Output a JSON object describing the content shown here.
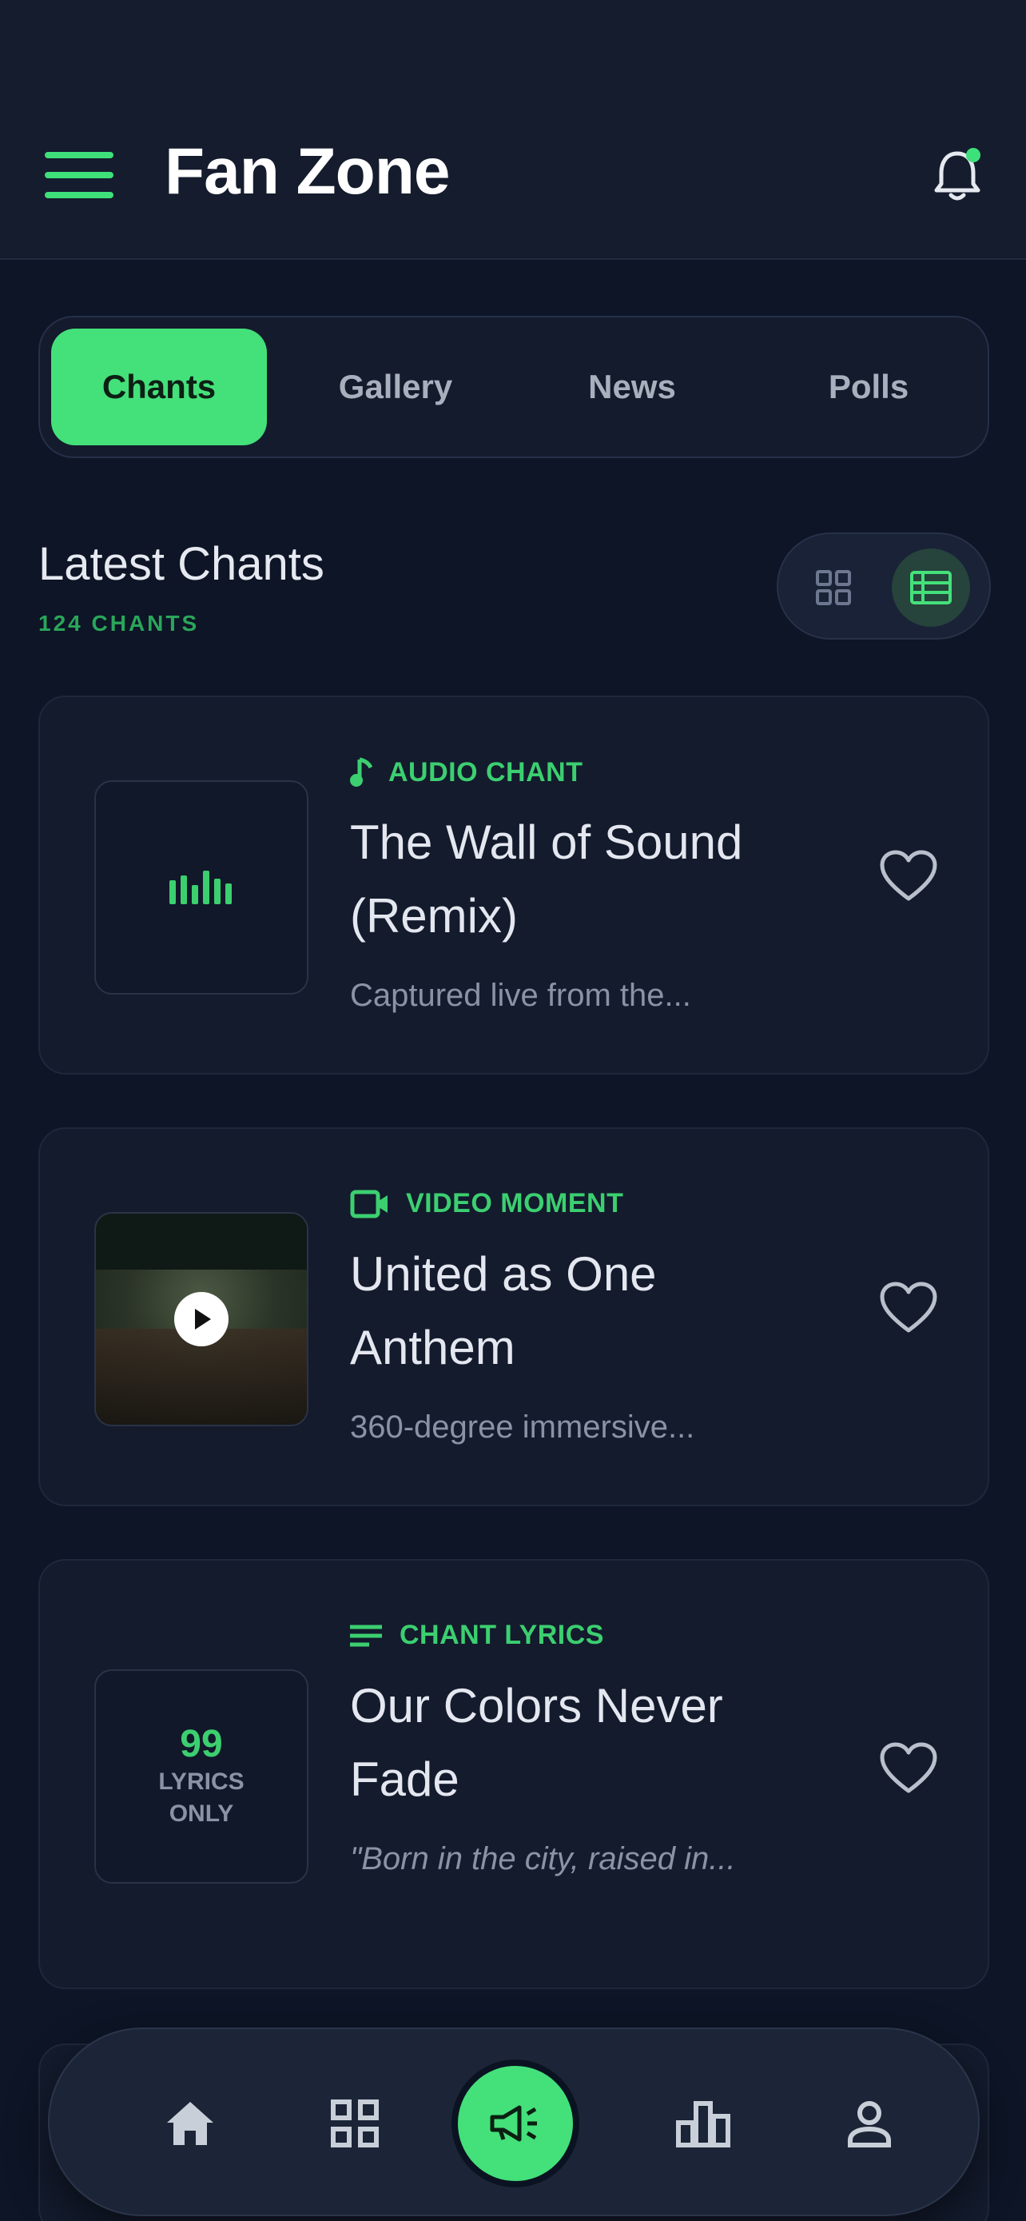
{
  "header": {
    "title": "Fan Zone",
    "menu_icon": "hamburger-menu-icon",
    "notification_icon": "bell-icon",
    "notification_dot_color": "#3ee07a"
  },
  "tabs": [
    {
      "label": "Chants",
      "active": true
    },
    {
      "label": "Gallery",
      "active": false
    },
    {
      "label": "News",
      "active": false
    },
    {
      "label": "Polls",
      "active": false
    }
  ],
  "section": {
    "title": "Latest Chants",
    "count": "124 CHANTS"
  },
  "view_toggle": {
    "options": [
      "grid",
      "list"
    ],
    "selected": "list"
  },
  "cards": [
    {
      "type": "AUDIO CHANT",
      "type_icon": "music-note-icon",
      "title": "The Wall of Sound (Remix)",
      "description": "Captured live from the...",
      "thumb": "audio-waveform-icon",
      "favorite_icon": "heart-icon"
    },
    {
      "type": "VIDEO MOMENT",
      "type_icon": "video-camera-icon",
      "title": "United as One Anthem",
      "description": "360-degree immersive...",
      "thumb": "video-thumbnail",
      "favorite_icon": "heart-icon"
    },
    {
      "type": "CHANT LYRICS",
      "type_icon": "lyrics-lines-icon",
      "title": "Our Colors Never Fade",
      "description": "\"Born in the city, raised in...",
      "thumb_label_big": "99",
      "thumb_label_small": "LYRICS ONLY",
      "favorite_icon": "heart-icon"
    }
  ],
  "bottom_nav": {
    "items": [
      "home-icon",
      "grid-icon",
      "megaphone-icon",
      "leaderboard-icon",
      "profile-icon"
    ],
    "active": "megaphone-icon"
  },
  "colors": {
    "accent": "#44e07a",
    "background": "#0d1526",
    "card": "#131b2d"
  }
}
